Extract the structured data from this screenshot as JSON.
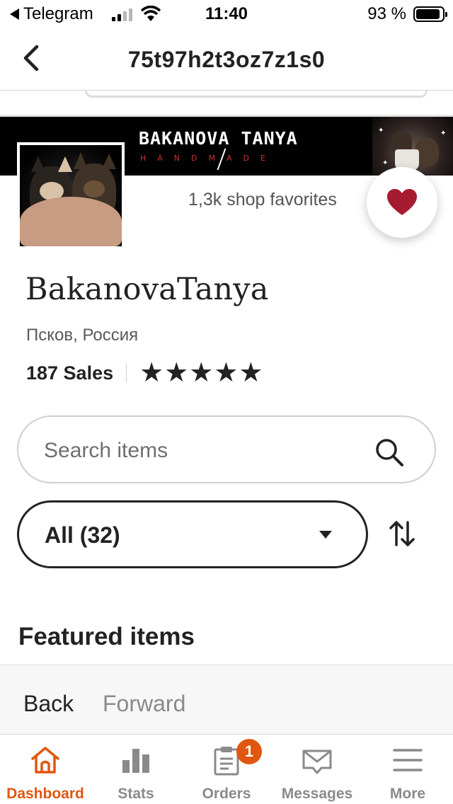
{
  "status_bar": {
    "back_app": "Telegram",
    "time": "11:40",
    "battery": "93 %"
  },
  "nav": {
    "title": "75t97h2t3oz7z1s0"
  },
  "banner": {
    "logo_text": "BAKANOVA TANYA",
    "sub_text": "HANDMADE"
  },
  "shop": {
    "favorites": "1,3k shop favorites",
    "name": "BakanovaTanya",
    "location": "Псков, Россия",
    "sales": "187 Sales",
    "rating_stars": 5
  },
  "search": {
    "placeholder": "Search items"
  },
  "filter": {
    "selected": "All (32)"
  },
  "featured": {
    "title": "Featured items"
  },
  "browser": {
    "back": "Back",
    "forward": "Forward"
  },
  "tabs": [
    {
      "label": "Dashboard",
      "icon": "home-icon",
      "active": true
    },
    {
      "label": "Stats",
      "icon": "bar-chart-icon",
      "active": false
    },
    {
      "label": "Orders",
      "icon": "clipboard-icon",
      "active": false,
      "badge": "1"
    },
    {
      "label": "Messages",
      "icon": "envelope-icon",
      "active": false
    },
    {
      "label": "More",
      "icon": "menu-icon",
      "active": false
    }
  ],
  "colors": {
    "accent": "#e0570f",
    "heart": "#a51c30",
    "text": "#222222"
  }
}
